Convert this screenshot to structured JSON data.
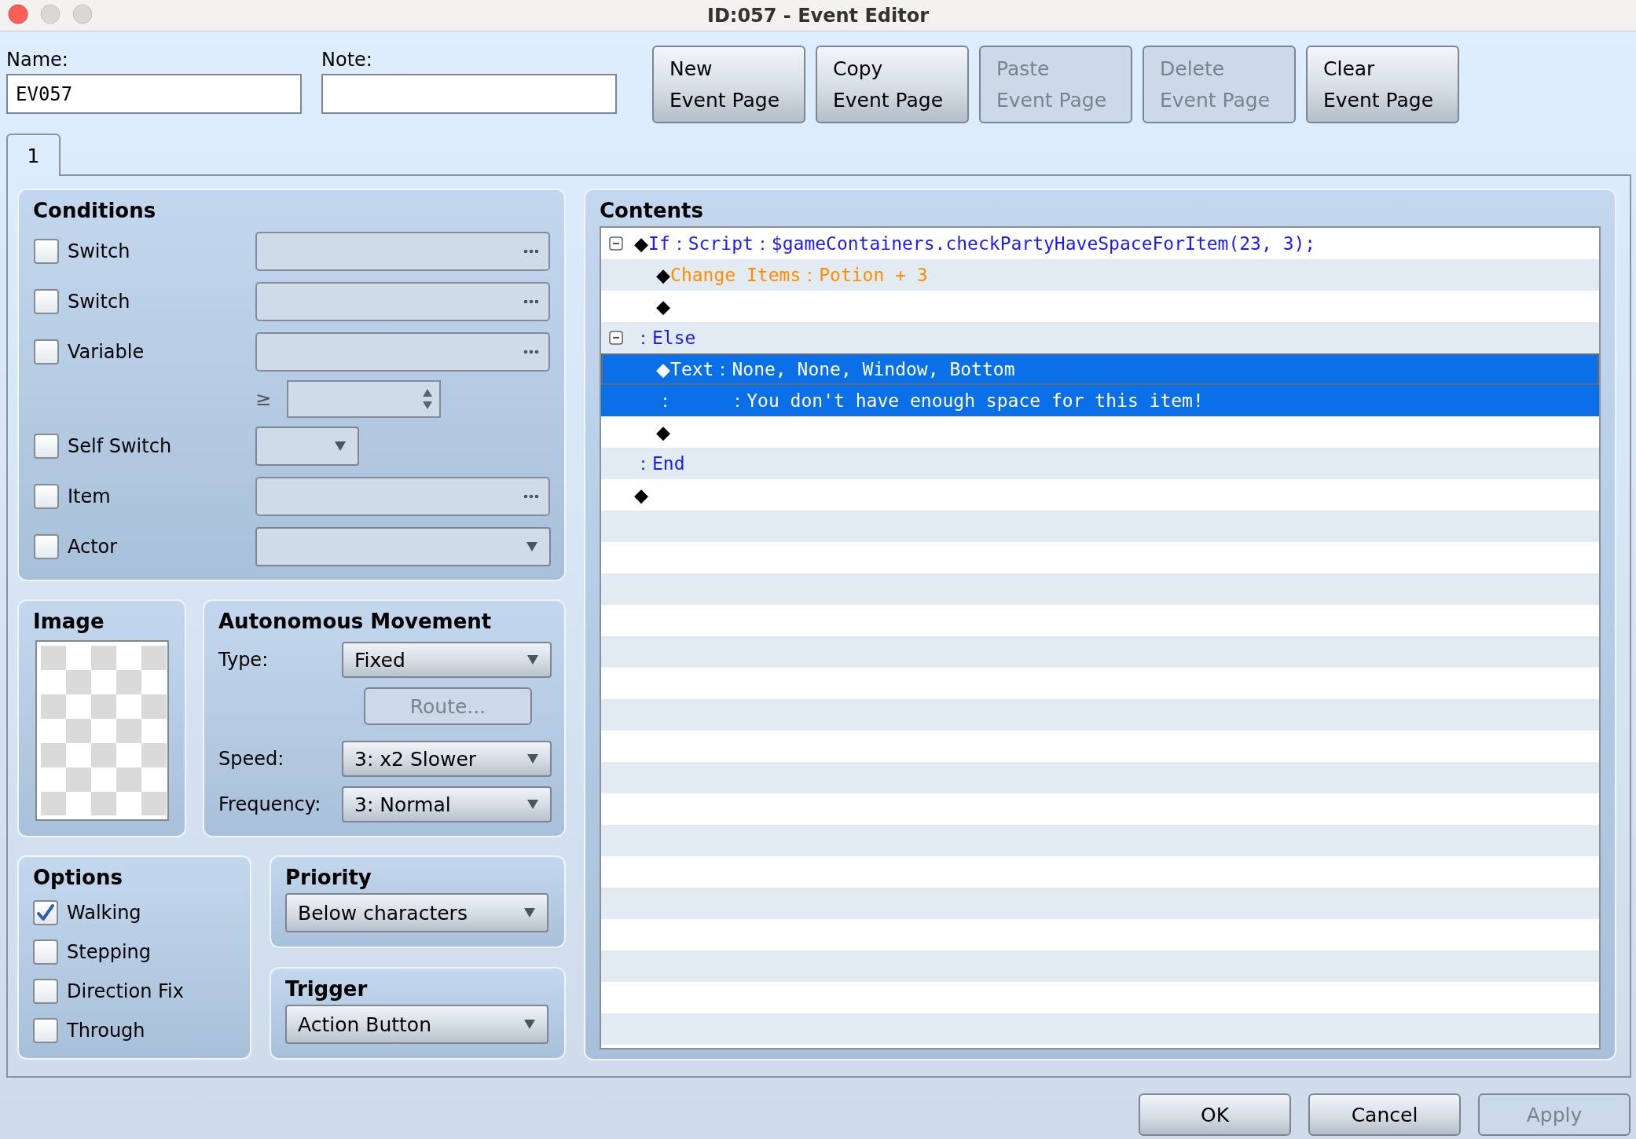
{
  "window": {
    "title": "ID:057 - Event Editor"
  },
  "name": {
    "label": "Name:",
    "value": "EV057"
  },
  "note": {
    "label": "Note:"
  },
  "page_buttons": [
    {
      "lines": [
        "New",
        "Event Page"
      ],
      "disabled": false
    },
    {
      "lines": [
        "Copy",
        "Event Page"
      ],
      "disabled": false
    },
    {
      "lines": [
        "Paste",
        "Event Page"
      ],
      "disabled": true
    },
    {
      "lines": [
        "Delete",
        "Event Page"
      ],
      "disabled": true
    },
    {
      "lines": [
        "Clear",
        "Event Page"
      ],
      "disabled": false
    }
  ],
  "tabs": [
    {
      "label": "1",
      "selected": true
    }
  ],
  "conditions": {
    "title": "Conditions",
    "items": [
      {
        "kind": "picker",
        "label": "Switch",
        "checked": false,
        "disabled": true
      },
      {
        "kind": "picker",
        "label": "Switch",
        "checked": false,
        "disabled": true
      },
      {
        "kind": "compare",
        "label": "Variable",
        "checked": false,
        "disabled": true,
        "operator": "≥"
      },
      {
        "kind": "letter",
        "label": "Self Switch",
        "checked": false,
        "disabled": true
      },
      {
        "kind": "picker",
        "label": "Item",
        "checked": false,
        "disabled": true
      },
      {
        "kind": "dropdown",
        "label": "Actor",
        "checked": false,
        "disabled": true
      }
    ]
  },
  "image": {
    "title": "Image"
  },
  "movement": {
    "title": "Autonomous Movement",
    "type": {
      "label": "Type:",
      "value": "Fixed"
    },
    "route": {
      "label": "Route...",
      "disabled": true
    },
    "speed": {
      "label": "Speed:",
      "value": "3: x2 Slower"
    },
    "frequency": {
      "label": "Frequency:",
      "value": "3: Normal"
    }
  },
  "options": {
    "title": "Options",
    "items": [
      {
        "label": "Walking",
        "checked": true
      },
      {
        "label": "Stepping",
        "checked": false
      },
      {
        "label": "Direction Fix",
        "checked": false
      },
      {
        "label": "Through",
        "checked": false
      }
    ]
  },
  "priority": {
    "title": "Priority",
    "value": "Below characters"
  },
  "trigger": {
    "title": "Trigger",
    "value": "Action Button"
  },
  "contents": {
    "title": "Contents",
    "commands": [
      {
        "expanded": true,
        "selected": false,
        "marker": "◆",
        "text": "If：Script：$gameContainers.checkPartyHaveSpaceForItem(23, 3);",
        "color": "#1a1aff",
        "children": [
          {
            "selected": false,
            "marker": "◆",
            "text": "Change Items：Potion + 3",
            "color": "#ff8c00"
          },
          {
            "selected": false,
            "marker": "◆"
          }
        ]
      },
      {
        "expanded": true,
        "selected": false,
        "text": "：Else",
        "color": "#1a1aff",
        "children": [
          {
            "selected": true,
            "marker": "◆",
            "text": "Text：None, None, Window, Bottom"
          },
          {
            "selected": true,
            "text": "：     ：You don't have enough space for this item!"
          },
          {
            "selected": false,
            "marker": "◆"
          }
        ]
      },
      {
        "selected": false,
        "text": "：End",
        "color": "#1a1aff"
      },
      {
        "selected": false,
        "marker": "◆"
      }
    ]
  },
  "dialog_buttons": [
    {
      "label": "OK",
      "disabled": false
    },
    {
      "label": "Cancel",
      "disabled": false
    },
    {
      "label": "Apply",
      "disabled": true
    }
  ]
}
